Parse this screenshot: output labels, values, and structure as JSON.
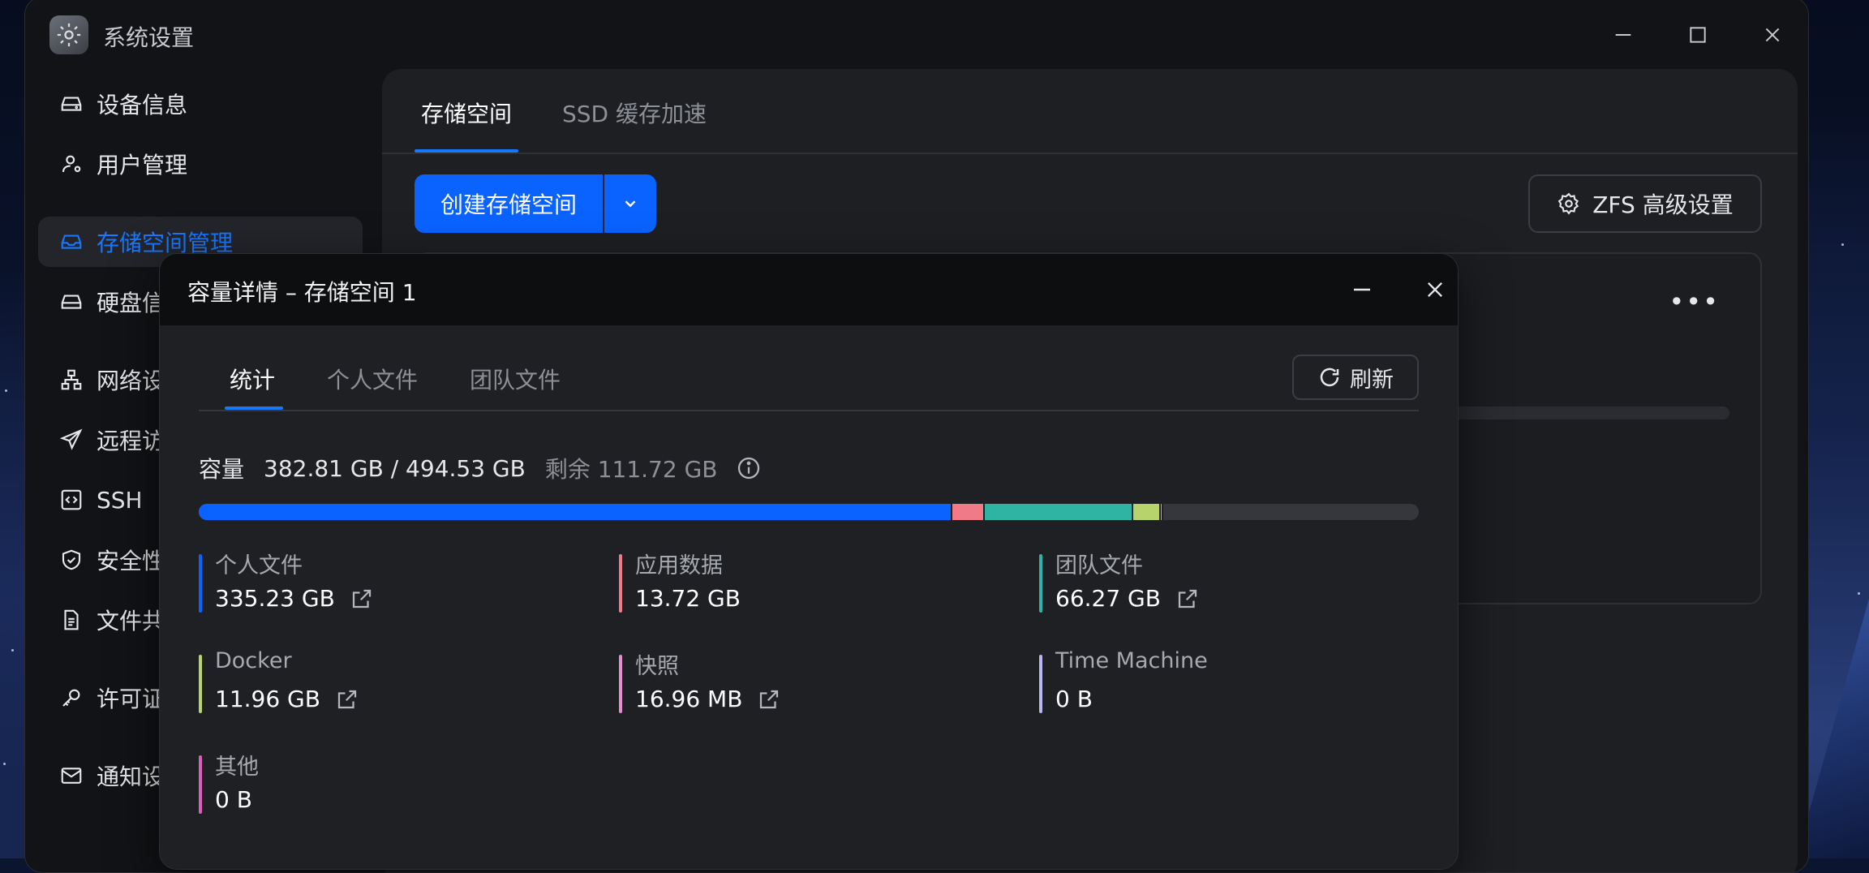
{
  "window": {
    "title": "系统设置"
  },
  "sidebar": {
    "items": [
      {
        "label": "设备信息",
        "icon": "device-icon"
      },
      {
        "label": "用户管理",
        "icon": "user-icon"
      },
      {
        "label": "存储空间管理",
        "icon": "storage-icon",
        "active": true
      },
      {
        "label": "硬盘信息",
        "icon": "disk-icon"
      },
      {
        "label": "网络设置",
        "icon": "network-icon"
      },
      {
        "label": "远程访问",
        "icon": "send-icon"
      },
      {
        "label": "SSH",
        "icon": "code-icon"
      },
      {
        "label": "安全性",
        "icon": "shield-icon"
      },
      {
        "label": "文件共享",
        "icon": "document-icon"
      },
      {
        "label": "许可证",
        "icon": "key-icon"
      },
      {
        "label": "通知设置",
        "icon": "mail-icon"
      }
    ]
  },
  "content": {
    "tabs": [
      "存储空间",
      "SSD 缓存加速"
    ],
    "create_button": "创建存储空间",
    "zfs_button": "ZFS 高级设置"
  },
  "dialog": {
    "title": "容量详情 – 存储空间 1",
    "tabs": [
      "统计",
      "个人文件",
      "团队文件"
    ],
    "refresh": "刷新",
    "capacity": {
      "label": "容量",
      "value": "382.81 GB / 494.53 GB",
      "free": "剩余 111.72 GB"
    },
    "legend": [
      {
        "name": "个人文件",
        "value": "335.23 GB",
        "color": "#0a63ff",
        "link": true
      },
      {
        "name": "应用数据",
        "value": "13.72 GB",
        "color": "#f07a86",
        "link": false
      },
      {
        "name": "团队文件",
        "value": "66.27 GB",
        "color": "#2fb3a3",
        "link": true
      },
      {
        "name": "Docker",
        "value": "11.96 GB",
        "color": "#b7d36b",
        "link": true
      },
      {
        "name": "快照",
        "value": "16.96 MB",
        "color": "#e58fd0",
        "link": true
      },
      {
        "name": "Time Machine",
        "value": "0 B",
        "color": "#b9b6f2",
        "link": false
      },
      {
        "name": "其他",
        "value": "0 B",
        "color": "#d860b8",
        "link": false
      }
    ],
    "bar_fraction": [
      {
        "name": "个人文件",
        "fraction": 0.6178
      },
      {
        "name": "应用数据",
        "fraction": 0.0264
      },
      {
        "name": "团队文件",
        "fraction": 0.1221
      },
      {
        "name": "Docker",
        "fraction": 0.0223
      },
      {
        "name": "快照",
        "fraction": 0.002
      },
      {
        "name": "free",
        "fraction": 0.2094
      }
    ]
  }
}
